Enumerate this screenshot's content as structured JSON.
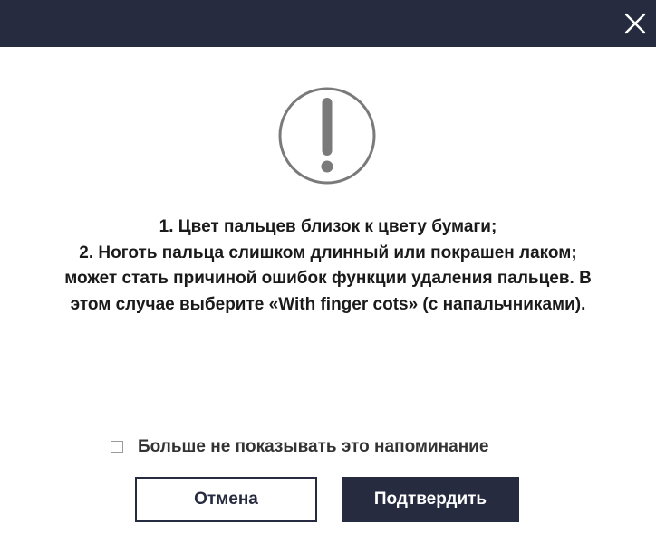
{
  "titlebar": {
    "close_icon": "close-icon",
    "color": "#262b40"
  },
  "warning": {
    "icon": "exclamation-circle-icon",
    "color": "#7a7a7a"
  },
  "message": {
    "lines": [
      "1. Цвет пальцев близок к цвету бумаги;",
      "2. Ноготь пальца слишком длинный или покрашен лаком;",
      "может стать причиной ошибок функции удаления пальцев. В",
      "этом случае выберите «With finger cots» (с напальчниками)."
    ]
  },
  "reminder": {
    "checked": false,
    "label": "Больше не показывать это напоминание"
  },
  "buttons": {
    "cancel_label": "Отмена",
    "confirm_label": "Подтвердить"
  }
}
